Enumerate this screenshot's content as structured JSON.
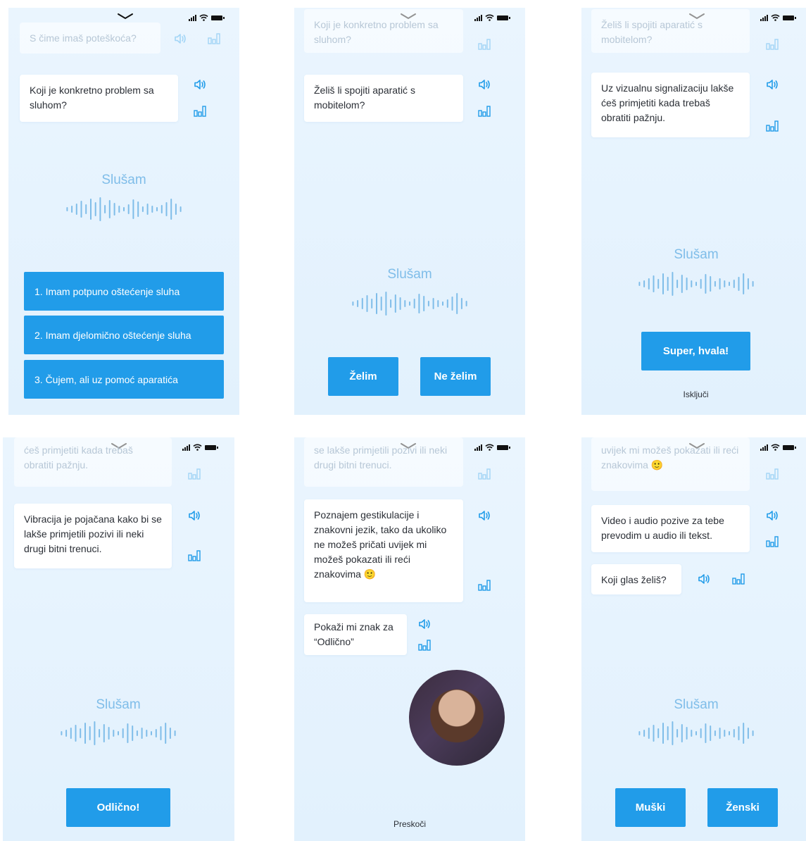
{
  "colors": {
    "accent": "#219ce9",
    "listening": "#7fbde9",
    "screen_bg": "#e6f3fe"
  },
  "status_bar": {
    "icons": [
      "signal-icon",
      "wifi-icon",
      "battery-icon"
    ]
  },
  "listening_label": "Slušam",
  "screens": {
    "s1": {
      "faded_prompt": "S čime imaš poteškoća?",
      "question": "Koji je konkretno problem sa sluhom?",
      "options": [
        "1. Imam potpuno oštećenje sluha",
        "2. Imam djelomično oštećenje sluha",
        "3. Čujem, ali uz pomoć aparatića"
      ]
    },
    "s2": {
      "faded_prompt": "Koji je konkretno problem sa sluhom?",
      "question": "Želiš li spojiti aparatić s mobitelom?",
      "yes": "Želim",
      "no": "Ne želim"
    },
    "s3": {
      "faded_prompt": "Želiš li spojiti aparatić s mobitelom?",
      "message": "Uz vizualnu signalizaciju lakše ćeš primjetiti kada trebaš obratiti pažnju.",
      "confirm": "Super, hvala!",
      "turn_off": "Isključi"
    },
    "s4": {
      "faded_prompt": "ćeš primjetiti kada trebaš obratiti pažnju.",
      "message": "Vibracija je pojačana kako bi se lakše primjetili pozivi ili neki drugi bitni trenuci.",
      "confirm": "Odlično!"
    },
    "s5": {
      "faded_prompt": "se lakše primjetili pozivi ili neki drugi bitni trenuci.",
      "message": "Poznajem gestikulacije i znakovni jezik, tako da ukoliko ne možeš pričati uvijek mi možeš pokazati ili reći znakovima 🙂",
      "prompt": "Pokaži mi znak za “Odlično”",
      "skip": "Preskoči"
    },
    "s6": {
      "faded_prompt": "uvijek mi možeš pokazati ili reći znakovima 🙂",
      "message": "Video i audio pozive za tebe prevodim u audio ili tekst.",
      "question": "Koji glas želiš?",
      "male": "Muški",
      "female": "Ženski"
    }
  }
}
